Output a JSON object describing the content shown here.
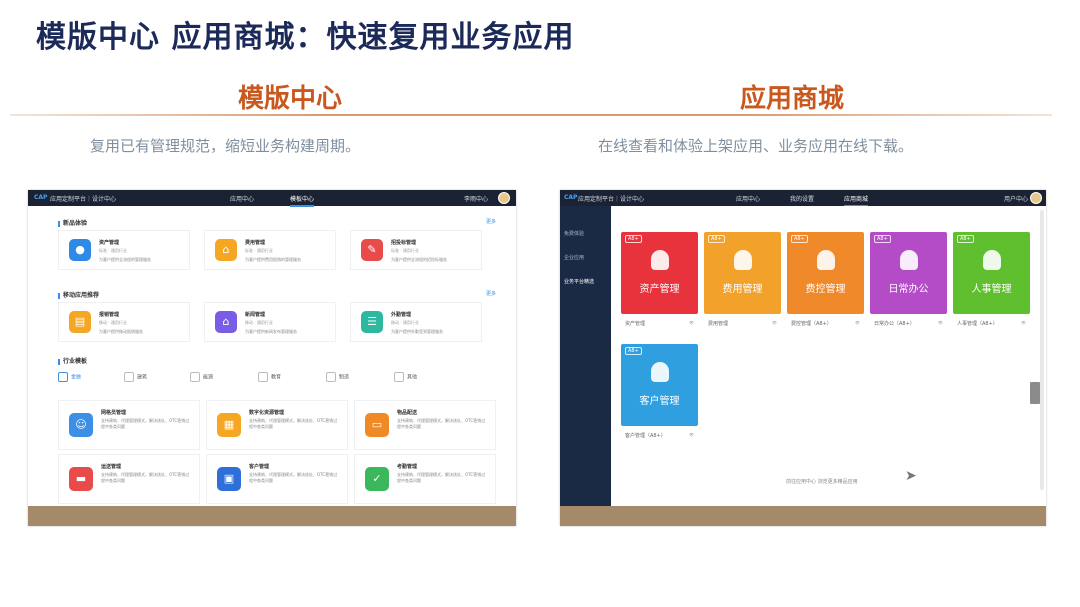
{
  "title": "模版中心 应用商城：快速复用业务应用",
  "left": {
    "heading": "模版中心",
    "desc": "复用已有管理规范，缩短业务构建周期。",
    "topbar": {
      "logo": "CAP",
      "app": "应用定制平台｜设计中心",
      "nav": [
        "应用中心",
        "模板中心"
      ],
      "user": "李雨中心"
    },
    "sections": [
      {
        "title": "新品体验",
        "more": "更多"
      },
      {
        "title": "移动应用推荐",
        "more": "更多"
      },
      {
        "title": "行业模板"
      }
    ],
    "cards_row1": [
      {
        "name": "资产管理",
        "sub": "标准 · 通用行业",
        "desc": "为客户提供全流程的管理服务",
        "color": "#2e8ae6",
        "icon": "database-icon"
      },
      {
        "name": "费用管理",
        "sub": "标准 · 通用行业",
        "desc": "为客户提供费用报销的管理服务",
        "color": "#f5a623",
        "icon": "house-icon"
      },
      {
        "name": "招投标管理",
        "sub": "标准 · 通用行业",
        "desc": "为客户提供全流程的招投标服务",
        "color": "#e94b4b",
        "icon": "gavel-icon"
      }
    ],
    "cards_row2": [
      {
        "name": "报销管理",
        "sub": "移动 · 通用行业",
        "desc": "为客户提供移动报销服务",
        "color": "#f5a623",
        "icon": "document-icon"
      },
      {
        "name": "新闻管理",
        "sub": "移动 · 通用行业",
        "desc": "为客户提供新闻发布管理服务",
        "color": "#7b5ce6",
        "icon": "home-icon"
      },
      {
        "name": "外勤管理",
        "sub": "移动 · 通用行业",
        "desc": "为客户提供外勤签到管理服务",
        "color": "#2fb8a0",
        "icon": "list-icon"
      }
    ],
    "industry_tabs": [
      "金融",
      "建筑",
      "能源",
      "教育",
      "制造",
      "其他"
    ],
    "industry_cards": [
      {
        "name": "网格员管理",
        "desc": "支持建筑、代理管理模式，解决选址、OTC营销过程中各类问题",
        "color": "#3b8fe6",
        "icon": "user-icon"
      },
      {
        "name": "数字化资源管理",
        "desc": "支持建筑、代理管理模式，解决选址、OTC营销过程中各类问题",
        "color": "#f5a623",
        "icon": "grid-icon"
      },
      {
        "name": "物品配送",
        "desc": "支持建筑、代理管理模式，解决选址、OTC营销过程中各类问题",
        "color": "#f08a24",
        "icon": "truck-icon"
      },
      {
        "name": "运送管理",
        "desc": "支持建筑、代理管理模式，解决选址、OTC营销过程中各类问题",
        "color": "#e94b4b",
        "icon": "box-icon"
      },
      {
        "name": "客户管理",
        "desc": "支持建筑、代理管理模式，解决选址、OTC营销过程中各类问题",
        "color": "#2e6fd8",
        "icon": "monitor-icon"
      },
      {
        "name": "考勤管理",
        "desc": "支持建筑、代理管理模式，解决选址、OTC营销过程中各类问题",
        "color": "#3bb85c",
        "icon": "check-icon"
      }
    ]
  },
  "right": {
    "heading": "应用商城",
    "desc": "在线查看和体验上架应用、业务应用在线下载。",
    "topbar": {
      "logo": "CAP",
      "app": "应用定制平台｜设计中心",
      "nav": [
        "应用中心",
        "我的设置",
        "应用商城"
      ],
      "user": "用户中心"
    },
    "sidebar": [
      "免费体验",
      "企业应用",
      "业务平台精选"
    ],
    "apps": [
      {
        "title": "资产管理",
        "badge": "A8+",
        "caption": "资产管理",
        "color": "#e8323c"
      },
      {
        "title": "费用管理",
        "badge": "A8+",
        "caption": "费用管理",
        "color": "#f2a12b"
      },
      {
        "title": "费控管理",
        "badge": "A8+",
        "caption": "费控管理（A8+）",
        "color": "#f0892a"
      },
      {
        "title": "日常办公",
        "badge": "A8+",
        "caption": "日常办公（A8+）",
        "color": "#b44cc8"
      },
      {
        "title": "人事管理",
        "badge": "A8+",
        "caption": "人事管理（A8+）",
        "color": "#5fbf2f"
      },
      {
        "title": "客户管理",
        "badge": "A8+",
        "caption": "客户管理（A8+）",
        "color": "#2f9fe0"
      }
    ],
    "footer": "前往应用中心  浏览更多精品应用"
  }
}
